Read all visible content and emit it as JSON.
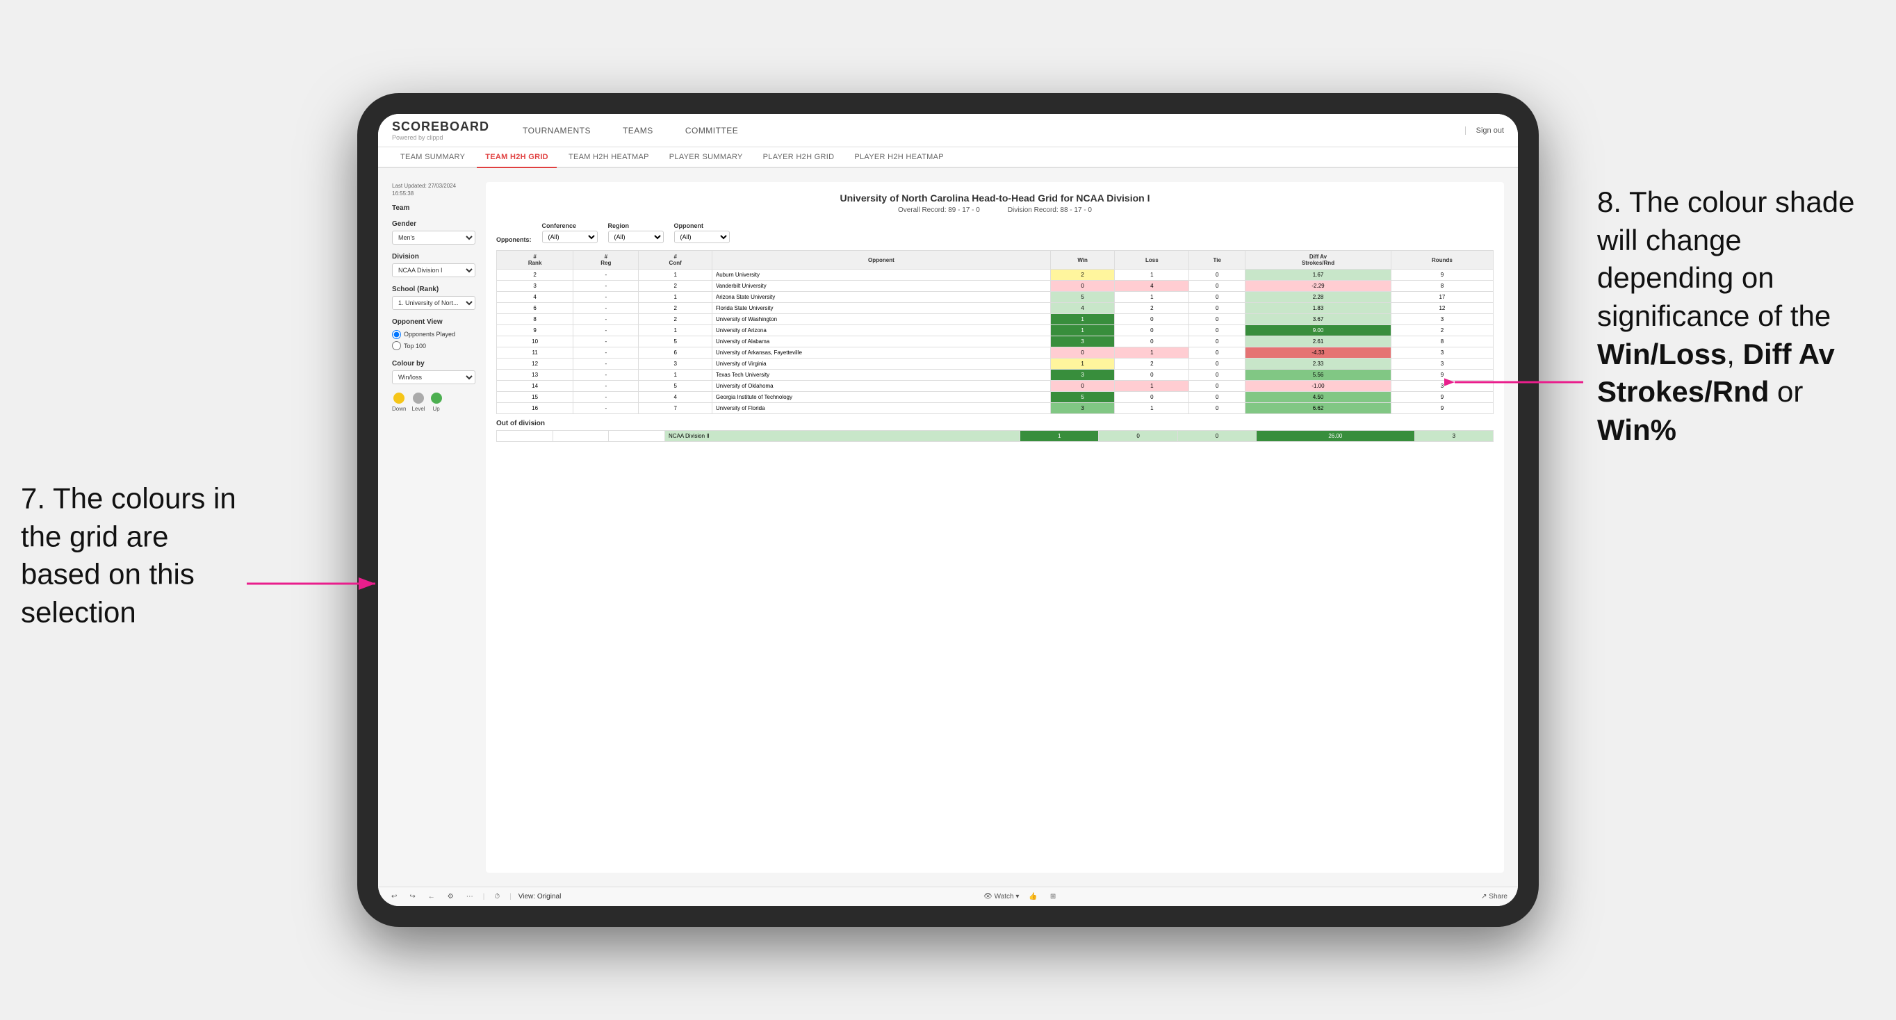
{
  "annotations": {
    "left_text": "7. The colours in the grid are based on this selection",
    "right_text_1": "8. The colour shade will change depending on significance of the ",
    "right_bold_1": "Win/Loss",
    "right_text_2": ", ",
    "right_bold_2": "Diff Av Strokes/Rnd",
    "right_text_3": " or ",
    "right_bold_3": "Win%"
  },
  "nav": {
    "logo": "SCOREBOARD",
    "logo_sub": "Powered by clippd",
    "items": [
      "TOURNAMENTS",
      "TEAMS",
      "COMMITTEE"
    ],
    "sign_out": "Sign out"
  },
  "sub_nav": {
    "items": [
      "TEAM SUMMARY",
      "TEAM H2H GRID",
      "TEAM H2H HEATMAP",
      "PLAYER SUMMARY",
      "PLAYER H2H GRID",
      "PLAYER H2H HEATMAP"
    ],
    "active": "TEAM H2H GRID"
  },
  "left_panel": {
    "last_updated_label": "Last Updated: 27/03/2024",
    "last_updated_time": "16:55:38",
    "team_label": "Team",
    "gender_label": "Gender",
    "gender_value": "Men's",
    "division_label": "Division",
    "division_value": "NCAA Division I",
    "school_label": "School (Rank)",
    "school_value": "1. University of Nort...",
    "opponent_view_label": "Opponent View",
    "radio_options": [
      "Opponents Played",
      "Top 100"
    ],
    "colour_by_label": "Colour by",
    "colour_by_value": "Win/loss",
    "legend": {
      "down_label": "Down",
      "level_label": "Level",
      "up_label": "Up",
      "down_color": "#f5c518",
      "level_color": "#aaaaaa",
      "up_color": "#4caf50"
    }
  },
  "grid": {
    "title": "University of North Carolina Head-to-Head Grid for NCAA Division I",
    "overall_record": "Overall Record: 89 - 17 - 0",
    "division_record": "Division Record: 88 - 17 - 0",
    "filters": {
      "conference_label": "Conference",
      "conference_value": "(All)",
      "region_label": "Region",
      "region_value": "(All)",
      "opponent_label": "Opponent",
      "opponent_value": "(All)",
      "opponents_label": "Opponents:"
    },
    "columns": [
      "#\nRank",
      "#\nReg",
      "#\nConf",
      "Opponent",
      "Win",
      "Loss",
      "Tie",
      "Diff Av\nStrokes/Rnd",
      "Rounds"
    ],
    "rows": [
      {
        "rank": "2",
        "reg": "-",
        "conf": "1",
        "opponent": "Auburn University",
        "win": "2",
        "loss": "1",
        "tie": "0",
        "diff": "1.67",
        "rounds": "9",
        "win_color": "yellow",
        "diff_color": "green_light"
      },
      {
        "rank": "3",
        "reg": "-",
        "conf": "2",
        "opponent": "Vanderbilt University",
        "win": "0",
        "loss": "4",
        "tie": "0",
        "diff": "-2.29",
        "rounds": "8",
        "win_color": "red_light",
        "diff_color": "red_light"
      },
      {
        "rank": "4",
        "reg": "-",
        "conf": "1",
        "opponent": "Arizona State University",
        "win": "5",
        "loss": "1",
        "tie": "0",
        "diff": "2.28",
        "rounds": "17",
        "win_color": "green_light",
        "diff_color": "green_light"
      },
      {
        "rank": "6",
        "reg": "-",
        "conf": "2",
        "opponent": "Florida State University",
        "win": "4",
        "loss": "2",
        "tie": "0",
        "diff": "1.83",
        "rounds": "12",
        "win_color": "green_light",
        "diff_color": "green_light"
      },
      {
        "rank": "8",
        "reg": "-",
        "conf": "2",
        "opponent": "University of Washington",
        "win": "1",
        "loss": "0",
        "tie": "0",
        "diff": "3.67",
        "rounds": "3",
        "win_color": "green_dark",
        "diff_color": "green_light"
      },
      {
        "rank": "9",
        "reg": "-",
        "conf": "1",
        "opponent": "University of Arizona",
        "win": "1",
        "loss": "0",
        "tie": "0",
        "diff": "9.00",
        "rounds": "2",
        "win_color": "green_dark",
        "diff_color": "green_dark"
      },
      {
        "rank": "10",
        "reg": "-",
        "conf": "5",
        "opponent": "University of Alabama",
        "win": "3",
        "loss": "0",
        "tie": "0",
        "diff": "2.61",
        "rounds": "8",
        "win_color": "green_dark",
        "diff_color": "green_light"
      },
      {
        "rank": "11",
        "reg": "-",
        "conf": "6",
        "opponent": "University of Arkansas, Fayetteville",
        "win": "0",
        "loss": "1",
        "tie": "0",
        "diff": "-4.33",
        "rounds": "3",
        "win_color": "red_light",
        "diff_color": "red_medium"
      },
      {
        "rank": "12",
        "reg": "-",
        "conf": "3",
        "opponent": "University of Virginia",
        "win": "1",
        "loss": "2",
        "tie": "0",
        "diff": "2.33",
        "rounds": "3",
        "win_color": "yellow",
        "diff_color": "green_light"
      },
      {
        "rank": "13",
        "reg": "-",
        "conf": "1",
        "opponent": "Texas Tech University",
        "win": "3",
        "loss": "0",
        "tie": "0",
        "diff": "5.56",
        "rounds": "9",
        "win_color": "green_dark",
        "diff_color": "green_medium"
      },
      {
        "rank": "14",
        "reg": "-",
        "conf": "5",
        "opponent": "University of Oklahoma",
        "win": "0",
        "loss": "1",
        "tie": "0",
        "diff": "-1.00",
        "rounds": "3",
        "win_color": "red_light",
        "diff_color": "red_light"
      },
      {
        "rank": "15",
        "reg": "-",
        "conf": "4",
        "opponent": "Georgia Institute of Technology",
        "win": "5",
        "loss": "0",
        "tie": "0",
        "diff": "4.50",
        "rounds": "9",
        "win_color": "green_dark",
        "diff_color": "green_medium"
      },
      {
        "rank": "16",
        "reg": "-",
        "conf": "7",
        "opponent": "University of Florida",
        "win": "3",
        "loss": "1",
        "tie": "0",
        "diff": "6.62",
        "rounds": "9",
        "win_color": "green_medium",
        "diff_color": "green_medium"
      }
    ],
    "out_of_division_label": "Out of division",
    "out_of_division_row": {
      "opponent": "NCAA Division II",
      "win": "1",
      "loss": "0",
      "tie": "0",
      "diff": "26.00",
      "rounds": "3",
      "win_color": "green_dark",
      "diff_color": "green_dark"
    }
  },
  "toolbar": {
    "view_label": "View: Original",
    "watch_label": "Watch",
    "share_label": "Share"
  }
}
